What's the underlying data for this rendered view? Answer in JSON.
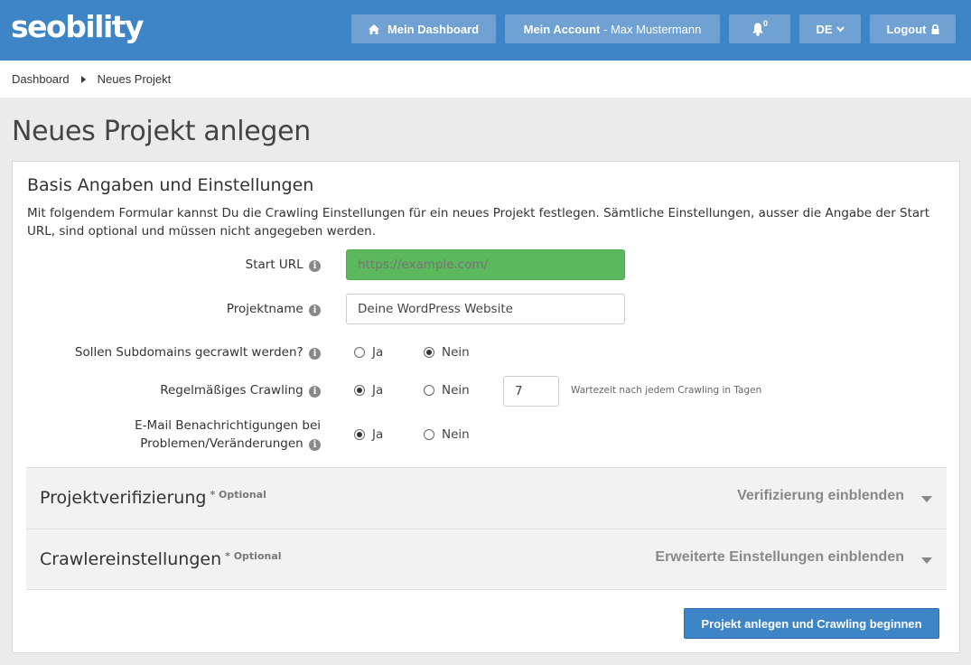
{
  "header": {
    "logo": "seobility",
    "dashboard_label": "Mein Dashboard",
    "account_label": "Mein Account",
    "account_sep": " - ",
    "account_user": "Max Mustermann",
    "notifications_count": "0",
    "language": "DE",
    "logout_label": "Logout"
  },
  "breadcrumb": {
    "items": [
      "Dashboard",
      "Neues Projekt"
    ]
  },
  "page": {
    "title": "Neues Projekt anlegen"
  },
  "basic": {
    "title": "Basis Angaben und Einstellungen",
    "intro": "Mit folgendem Formular kannst Du die Crawling Einstellungen für ein neues Projekt festlegen. Sämtliche Einstellungen, ausser die Angabe der Start URL, sind optional und müssen nicht angegeben werden.",
    "start_url_label": "Start URL",
    "start_url_placeholder": "https://example.com/",
    "project_name_label": "Projektname",
    "project_name_value": "Deine WordPress Website",
    "subdomains_label": "Sollen Subdomains gecrawlt werden?",
    "regular_crawl_label": "Regelmäßiges Crawling",
    "email_label_line1": "E-Mail Benachrichtigungen bei",
    "email_label_line2": "Problemen/Veränderungen",
    "yes": "Ja",
    "no": "Nein",
    "crawl_interval_value": "7",
    "crawl_interval_hint": "Wartezeit nach jedem Crawling in Tagen",
    "subdomains_selected": "Nein",
    "regular_crawl_selected": "Ja",
    "email_selected": "Ja"
  },
  "verification": {
    "title": "Projektverifizierung",
    "optional": "* Optional",
    "toggle": "Verifizierung einblenden"
  },
  "crawler": {
    "title": "Crawlereinstellungen",
    "optional": "* Optional",
    "toggle": "Erweiterte Einstellungen einblenden"
  },
  "submit_label": "Projekt anlegen und Crawling beginnen",
  "colors": {
    "brand": "#3d85c6",
    "nav_button": "#6fa1d2",
    "url_field": "#5cb85c"
  }
}
